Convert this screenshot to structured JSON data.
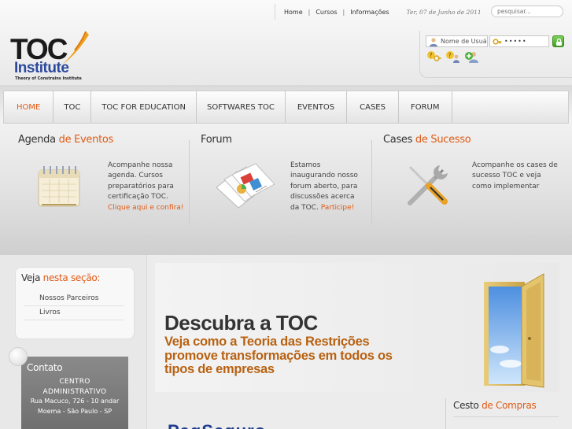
{
  "topbar": {
    "links": [
      "Home",
      "Cursos",
      "Informações"
    ],
    "date": "Ter, 07 de Junho de 2011",
    "search_placeholder": "pesquisar..."
  },
  "logo": {
    "main": "TOC",
    "institute": "Institute",
    "tagline": "Theory of Constrains Institute"
  },
  "login": {
    "username_placeholder": "Nome de Usuário",
    "password_value": "•••••"
  },
  "nav": {
    "items": [
      "HOME",
      "TOC",
      "TOC FOR EDUCATION",
      "SOFTWARES TOC",
      "EVENTOS",
      "CASES",
      "FORUM"
    ],
    "active": "HOME"
  },
  "panels": {
    "agenda": {
      "title_a": "Agenda ",
      "title_b": "de Eventos",
      "text": "Acompanhe nossa agenda. Cursos preparatórios para certificação TOC.",
      "link": "Clique aqui e confira!"
    },
    "forum": {
      "title_a": "Forum",
      "text": "Estamos inaugurando nosso forum aberto, para discussões acerca da TOC.",
      "link": "Participe!"
    },
    "cases": {
      "title_a": "Cases ",
      "title_b": "de Sucesso",
      "text": "Acompanhe os cases de sucesso TOC e veja como implementar"
    }
  },
  "veja": {
    "title_a": "Veja ",
    "title_b": "nesta seção:",
    "items": [
      "Nossos Parceiros",
      "Livros"
    ]
  },
  "contato": {
    "title": "Contato",
    "line1": "CENTRO",
    "line2": "ADMINISTRATIVO",
    "line3": "Rua Macuco, 726 - 10 andar",
    "line4": "Moema - São Paulo - SP"
  },
  "banner": {
    "headline": "Descubra a TOC",
    "subline": "Veja como a Teoria das Restrições promove transformações em todos os tipos de empresas"
  },
  "cesto": {
    "title_a": "Cesto ",
    "title_b": "de Compras"
  },
  "pay": {
    "a": "PagSeguro"
  },
  "colors": {
    "accent": "#e05a14",
    "banner_sub": "#b86212",
    "brand_blue": "#2c4a9e"
  }
}
